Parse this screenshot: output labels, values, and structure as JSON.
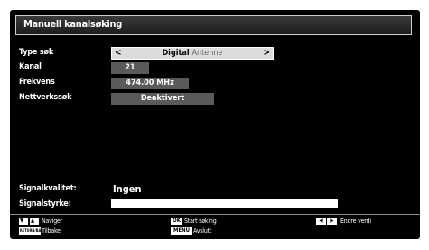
{
  "header": {
    "title": "Manuell kanalsøking"
  },
  "fields": {
    "type_label": "Type søk",
    "type_value": "Digital",
    "type_sub": "Antenne",
    "channel_label": "Kanal",
    "channel_value": "21",
    "frequency_label": "Frekvens",
    "frequency_value": "474.00 MHz",
    "network_label": "Nettverkssøk",
    "network_value": "Deaktivert"
  },
  "signal": {
    "quality_label": "Signalkvalitet:",
    "quality_value": "Ingen",
    "strength_label": "Signalstyrke:"
  },
  "footer": {
    "navigate": "Naviger",
    "back_key": "RETURN/BACK",
    "back": "Tilbake",
    "ok_key": "OK",
    "start": "Start søking",
    "menu_key": "MENU",
    "exit": "Avslutt",
    "change": "Endre verdi"
  }
}
